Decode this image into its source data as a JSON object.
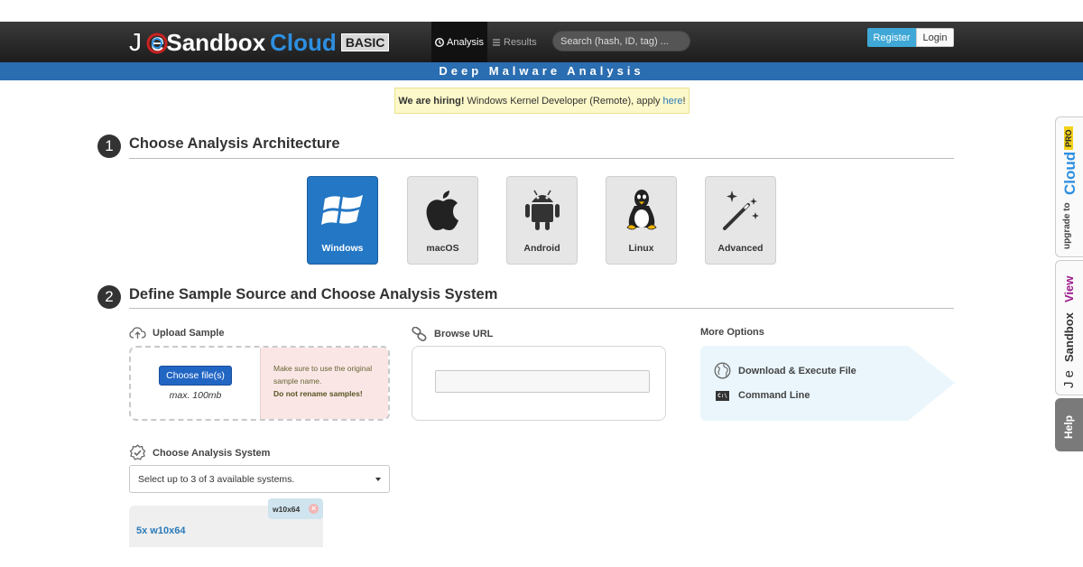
{
  "brand": {
    "joe": "J e",
    "sandbox": "Sandbox",
    "cloud": "Cloud",
    "edition": "BASIC"
  },
  "nav": {
    "analysis": "Analysis",
    "results": "Results"
  },
  "search": {
    "placeholder": "Search (hash, ID, tag) ..."
  },
  "auth": {
    "register": "Register",
    "login": "Login"
  },
  "tagline": "Deep Malware Analysis",
  "hiring": {
    "bold": "We are hiring!",
    "text": "Windows Kernel Developer (Remote), apply",
    "link": "here",
    "suffix": "!"
  },
  "step1": {
    "number": "1",
    "title": "Choose Analysis Architecture"
  },
  "architectures": [
    {
      "label": "Windows",
      "icon": "windows-icon",
      "selected": true
    },
    {
      "label": "macOS",
      "icon": "apple-icon",
      "selected": false
    },
    {
      "label": "Android",
      "icon": "android-icon",
      "selected": false
    },
    {
      "label": "Linux",
      "icon": "tux-icon",
      "selected": false
    },
    {
      "label": "Advanced",
      "icon": "magic-wand-icon",
      "selected": false
    }
  ],
  "step2": {
    "number": "2",
    "title": "Define Sample Source and Choose Analysis System"
  },
  "upload": {
    "label": "Upload Sample",
    "button": "Choose file(s)",
    "max": "max. 100mb",
    "note": "Make sure to use the original sample name.",
    "warning": "Do not rename samples!"
  },
  "browse": {
    "label": "Browse URL",
    "value": ""
  },
  "more": {
    "label": "More Options",
    "items": [
      {
        "label": "Download & Execute File",
        "icon": "globe-icon"
      },
      {
        "label": "Command Line",
        "icon": "terminal-icon",
        "badge": "C:\\"
      }
    ]
  },
  "system": {
    "label": "Choose Analysis System",
    "select": "Select up to 3 of 3 available systems.",
    "tag": "w10x64",
    "tag_remove": "×",
    "count": "5x w10x64"
  },
  "side": {
    "upgrade": "upgrade to",
    "cloud": "Cloud",
    "pro": "PRO",
    "view_joe": "J e",
    "view_sandbox": "Sandbox",
    "view_view": "View",
    "help": "Help"
  },
  "colors": {
    "accent": "#2477c4",
    "subbar": "#2a6db0",
    "link": "#2a7ab8",
    "register": "#3fa8d6",
    "hiring_bg": "#fcf8c9",
    "warning_bg": "#fbe6e6",
    "more_bg": "#eaf6fc"
  }
}
